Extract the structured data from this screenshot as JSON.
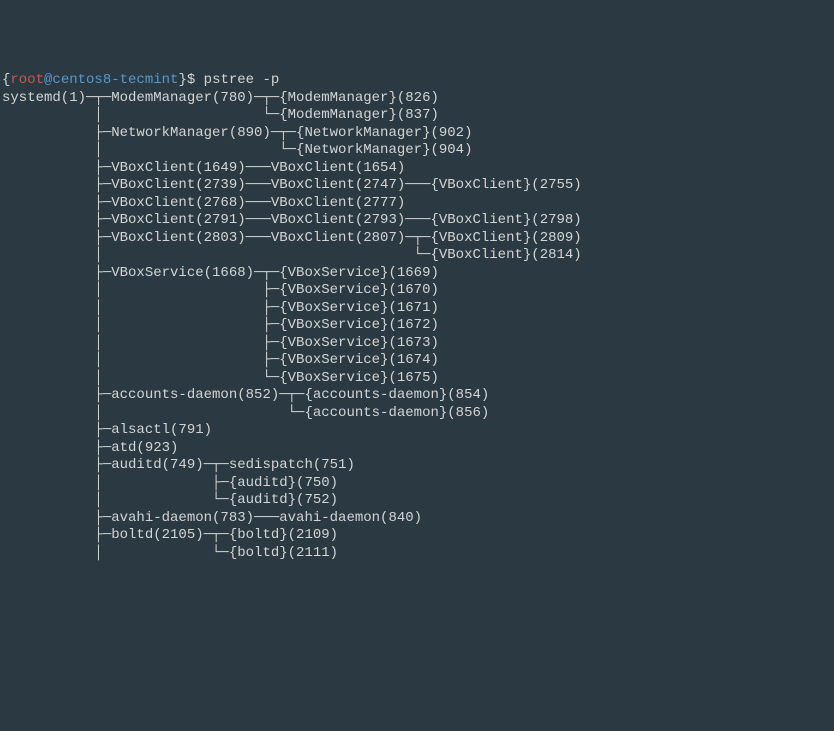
{
  "prompt": {
    "open_bracket": "{",
    "user": "root",
    "at": "@",
    "host": "centos8-tecmint",
    "close_bracket": "}",
    "symbol": "$ ",
    "command": "pstree -p"
  },
  "lines": {
    "l0": "systemd(1)─┬─ModemManager(780)─┬─{ModemManager}(826)",
    "l1": "           │                   └─{ModemManager}(837)",
    "l2": "           ├─NetworkManager(890)─┬─{NetworkManager}(902)",
    "l3": "           │                     └─{NetworkManager}(904)",
    "l4": "           ├─VBoxClient(1649)───VBoxClient(1654)",
    "l5": "           ├─VBoxClient(2739)───VBoxClient(2747)───{VBoxClient}(2755)",
    "l6": "           ├─VBoxClient(2768)───VBoxClient(2777)",
    "l7": "           ├─VBoxClient(2791)───VBoxClient(2793)───{VBoxClient}(2798)",
    "l8": "           ├─VBoxClient(2803)───VBoxClient(2807)─┬─{VBoxClient}(2809)",
    "l9": "           │                                     └─{VBoxClient}(2814)",
    "l10": "           ├─VBoxService(1668)─┬─{VBoxService}(1669)",
    "l11": "           │                   ├─{VBoxService}(1670)",
    "l12": "           │                   ├─{VBoxService}(1671)",
    "l13": "           │                   ├─{VBoxService}(1672)",
    "l14": "           │                   ├─{VBoxService}(1673)",
    "l15": "           │                   ├─{VBoxService}(1674)",
    "l16": "           │                   └─{VBoxService}(1675)",
    "l17": "           ├─accounts-daemon(852)─┬─{accounts-daemon}(854)",
    "l18": "           │                      └─{accounts-daemon}(856)",
    "l19": "           ├─alsactl(791)",
    "l20": "           ├─atd(923)",
    "l21": "           ├─auditd(749)─┬─sedispatch(751)",
    "l22": "           │             ├─{auditd}(750)",
    "l23": "           │             └─{auditd}(752)",
    "l24": "           ├─avahi-daemon(783)───avahi-daemon(840)",
    "l25": "           ├─boltd(2105)─┬─{boltd}(2109)",
    "l26": "           │             └─{boltd}(2111)"
  }
}
